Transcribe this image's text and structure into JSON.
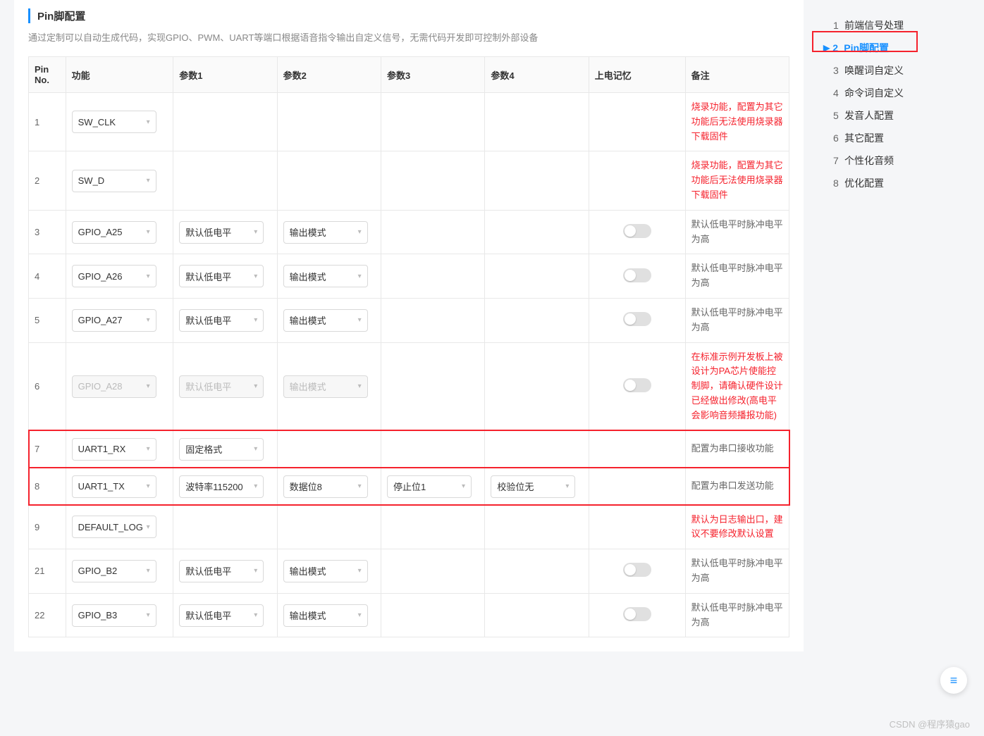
{
  "section": {
    "title": "Pin脚配置",
    "description": "通过定制可以自动生成代码，实现GPIO、PWM、UART等端口根据语音指令输出自定义信号，无需代码开发即可控制外部设备"
  },
  "headers": {
    "pin_no": "Pin No.",
    "func": "功能",
    "p1": "参数1",
    "p2": "参数2",
    "p3": "参数3",
    "p4": "参数4",
    "memory": "上电记忆",
    "note": "备注"
  },
  "rows": [
    {
      "no": "1",
      "func": "SW_CLK",
      "note": "烧录功能，配置为其它功能后无法使用烧录器下载固件",
      "note_red": true
    },
    {
      "no": "2",
      "func": "SW_D",
      "note": "烧录功能，配置为其它功能后无法使用烧录器下载固件",
      "note_red": true
    },
    {
      "no": "3",
      "func": "GPIO_A25",
      "p1": "默认低电平",
      "p2": "输出模式",
      "toggle": true,
      "note": "默认低电平时脉冲电平为高"
    },
    {
      "no": "4",
      "func": "GPIO_A26",
      "p1": "默认低电平",
      "p2": "输出模式",
      "toggle": true,
      "note": "默认低电平时脉冲电平为高"
    },
    {
      "no": "5",
      "func": "GPIO_A27",
      "p1": "默认低电平",
      "p2": "输出模式",
      "toggle": true,
      "note": "默认低电平时脉冲电平为高"
    },
    {
      "no": "6",
      "func": "GPIO_A28",
      "p1": "默认低电平",
      "p2": "输出模式",
      "toggle": true,
      "disabled": true,
      "note": "在标准示例开发板上被设计为PA芯片使能控制脚，请确认硬件设计已经做出修改(高电平会影响音频播报功能)",
      "note_red": true
    },
    {
      "no": "7",
      "func": "UART1_RX",
      "p1": "固定格式",
      "note": "配置为串口接收功能",
      "hl": true
    },
    {
      "no": "8",
      "func": "UART1_TX",
      "p1": "波特率115200",
      "p2": "数据位8",
      "p3": "停止位1",
      "p4": "校验位无",
      "note": "配置为串口发送功能",
      "hl": true
    },
    {
      "no": "9",
      "func": "DEFAULT_LOG",
      "note": "默认为日志输出口，建议不要修改默认设置",
      "note_red": true
    },
    {
      "no": "21",
      "func": "GPIO_B2",
      "p1": "默认低电平",
      "p2": "输出模式",
      "toggle": true,
      "note": "默认低电平时脉冲电平为高"
    },
    {
      "no": "22",
      "func": "GPIO_B3",
      "p1": "默认低电平",
      "p2": "输出模式",
      "toggle": true,
      "note": "默认低电平时脉冲电平为高"
    }
  ],
  "toc": [
    {
      "num": "1",
      "label": "前端信号处理"
    },
    {
      "num": "2",
      "label": "Pin脚配置",
      "active": true
    },
    {
      "num": "3",
      "label": "唤醒词自定义"
    },
    {
      "num": "4",
      "label": "命令词自定义"
    },
    {
      "num": "5",
      "label": "发音人配置"
    },
    {
      "num": "6",
      "label": "其它配置"
    },
    {
      "num": "7",
      "label": "个性化音频"
    },
    {
      "num": "8",
      "label": "优化配置"
    }
  ],
  "watermark": "CSDN @程序猿gao",
  "float_icon": "≡"
}
